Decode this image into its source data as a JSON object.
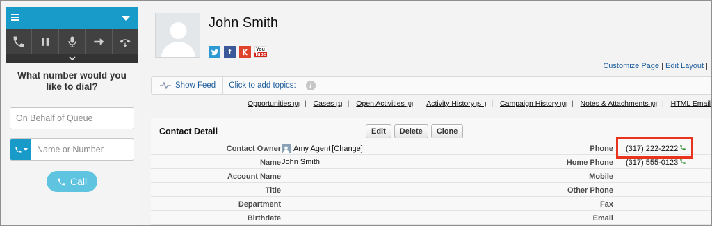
{
  "softphone": {
    "question": "What number would you like to dial?",
    "queue_placeholder": "On Behalf of Queue",
    "number_placeholder": "Name or Number",
    "call_label": "Call",
    "controls": [
      "phone-icon",
      "pause-icon",
      "microphone-icon",
      "arrow-right-icon",
      "hangup-icon"
    ],
    "accent_color": "#199bc9"
  },
  "contact": {
    "name": "John Smith",
    "social": {
      "facebook": "f",
      "youtube_top": "You",
      "youtube_bottom": "Tube"
    }
  },
  "top_links": {
    "customize": "Customize Page",
    "separator": "|",
    "edit_layout": "Edit Layout",
    "trailing": "|"
  },
  "feed_bar": {
    "show_feed": "Show Feed",
    "topics": "Click to add topics:",
    "info": "i"
  },
  "related_lists": [
    {
      "label": "Opportunities",
      "count": "[0]"
    },
    {
      "label": "Cases",
      "count": "[1]"
    },
    {
      "label": "Open Activities",
      "count": "[0]"
    },
    {
      "label": "Activity History",
      "count": "[5+]"
    },
    {
      "label": "Campaign History",
      "count": "[0]"
    },
    {
      "label": "Notes & Attachments",
      "count": "[0]"
    },
    {
      "label": "HTML Email",
      "count": ""
    }
  ],
  "detail": {
    "title": "Contact Detail",
    "buttons": {
      "edit": "Edit",
      "delete": "Delete",
      "clone": "Clone"
    },
    "left": [
      {
        "label": "Contact Owner",
        "value": "Amy Agent",
        "change": "[Change]"
      },
      {
        "label": "Name",
        "value": "John Smith"
      },
      {
        "label": "Account Name",
        "value": ""
      },
      {
        "label": "Title",
        "value": ""
      },
      {
        "label": "Department",
        "value": ""
      },
      {
        "label": "Birthdate",
        "value": ""
      }
    ],
    "right": [
      {
        "label": "Phone",
        "value": "(317) 222-2222"
      },
      {
        "label": "Home Phone",
        "value": "(317) 555-0123"
      },
      {
        "label": "Mobile",
        "value": ""
      },
      {
        "label": "Other Phone",
        "value": ""
      },
      {
        "label": "Fax",
        "value": ""
      },
      {
        "label": "Email",
        "value": ""
      }
    ],
    "highlight_color": "#e8341c"
  }
}
